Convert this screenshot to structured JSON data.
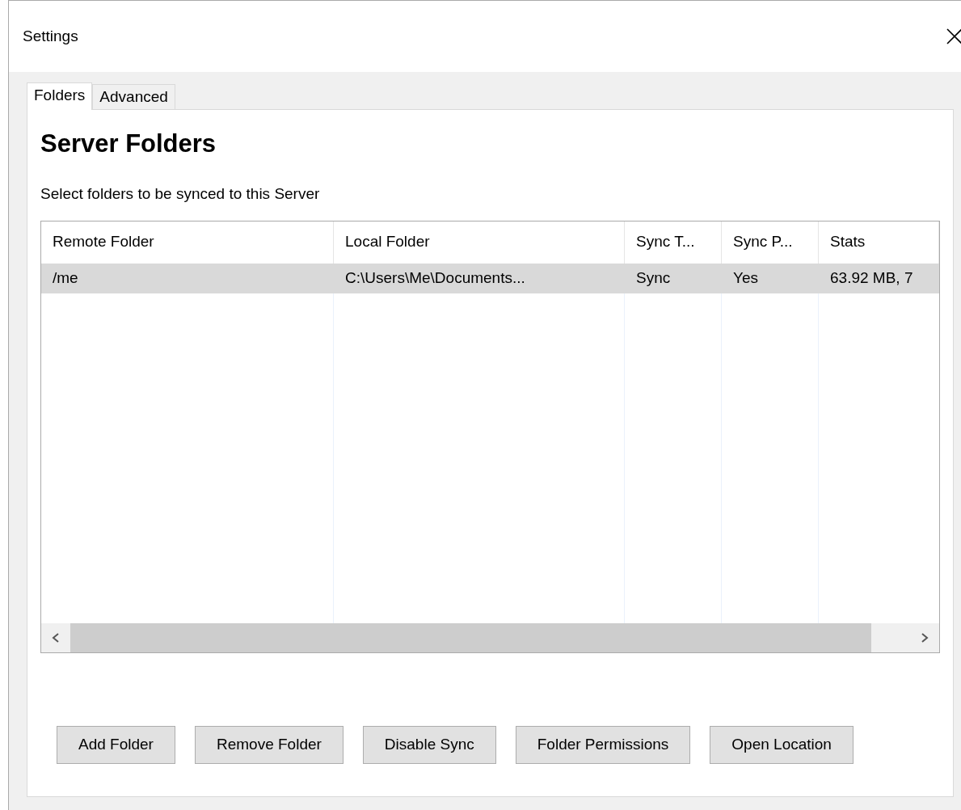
{
  "window": {
    "title": "Settings"
  },
  "tabs": [
    {
      "label": "Folders",
      "selected": true
    },
    {
      "label": "Advanced",
      "selected": false
    }
  ],
  "heading": "Server Folders",
  "subtitle": "Select folders to be synced to this Server",
  "table": {
    "columns": [
      "Remote Folder",
      "Local Folder",
      "Sync T...",
      "Sync P...",
      "Stats"
    ],
    "rows": [
      {
        "cells": [
          "/me",
          "C:\\Users\\Me\\Documents...",
          "Sync",
          "Yes",
          "63.92 MB, 7"
        ],
        "selected": true
      }
    ]
  },
  "buttons": [
    "Add Folder",
    "Remove Folder",
    "Disable Sync",
    "Folder Permissions",
    "Open Location"
  ]
}
